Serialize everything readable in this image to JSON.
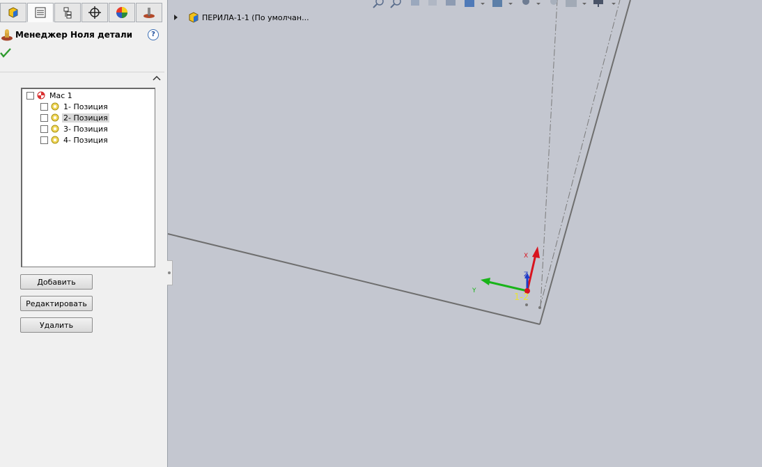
{
  "tabs": [
    {
      "icon": "feature-manager-icon",
      "active": false
    },
    {
      "icon": "property-manager-icon",
      "active": true
    },
    {
      "icon": "configuration-manager-icon",
      "active": false
    },
    {
      "icon": "dimxpert-icon",
      "active": false
    },
    {
      "icon": "display-manager-icon",
      "active": false
    },
    {
      "icon": "cam-manager-icon",
      "active": false
    }
  ],
  "property_manager": {
    "title": "Менеджер Ноля детали",
    "help": "?"
  },
  "tree": {
    "root": "Мас 1",
    "items": [
      {
        "label": "1- Позиция",
        "selected": false
      },
      {
        "label": "2- Позиция",
        "selected": true
      },
      {
        "label": "3- Позиция",
        "selected": false
      },
      {
        "label": "4- Позиция",
        "selected": false
      }
    ]
  },
  "buttons": {
    "add": "Добавить",
    "edit": "Редактировать",
    "delete": "Удалить"
  },
  "breadcrumb": {
    "text": "ПЕРИЛА-1-1  (По умолчан..."
  },
  "viewport": {
    "triad_x_label": "X",
    "triad_y_label": "Y",
    "triad_z_label": "Z",
    "origin_label": "1-2",
    "colors": {
      "background": "#c4c7d0",
      "edge": "#6e6e6e",
      "x_axis": "#d8141e",
      "y_axis": "#19b419",
      "z_axis": "#1e3cc8",
      "origin_label": "#e8e23a"
    }
  }
}
